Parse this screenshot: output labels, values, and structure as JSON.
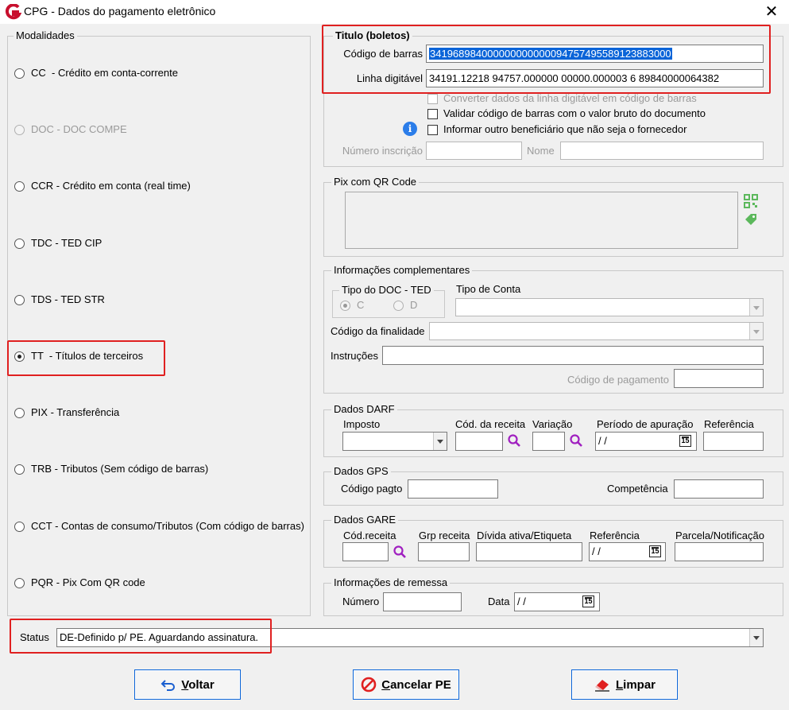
{
  "window": {
    "title": "CPG - Dados do pagamento eletrônico",
    "close": "✕"
  },
  "modalidades": {
    "legend": "Modalidades",
    "items": [
      {
        "label": "CC  - Crédito em conta-corrente",
        "selected": false,
        "disabled": false
      },
      {
        "label": "DOC - DOC COMPE",
        "selected": false,
        "disabled": true
      },
      {
        "label": "CCR - Crédito em conta (real time)",
        "selected": false,
        "disabled": false
      },
      {
        "label": "TDC - TED CIP",
        "selected": false,
        "disabled": false
      },
      {
        "label": "TDS - TED STR",
        "selected": false,
        "disabled": false
      },
      {
        "label": "TT  - Títulos de terceiros",
        "selected": true,
        "disabled": false
      },
      {
        "label": "PIX - Transferência",
        "selected": false,
        "disabled": false
      },
      {
        "label": "TRB - Tributos (Sem código de barras)",
        "selected": false,
        "disabled": false
      },
      {
        "label": "CCT - Contas de consumo/Tributos (Com código de barras)",
        "selected": false,
        "disabled": false
      },
      {
        "label": "PQR - Pix Com QR code",
        "selected": false,
        "disabled": false
      }
    ]
  },
  "titulo": {
    "legend": "Titulo (boletos)",
    "codigo_barras_label": "Código de barras",
    "codigo_barras_value": "34196898400000000000009475749558912388300​0",
    "linha_digitavel_label": "Linha digitável",
    "linha_digitavel_value": "34191.12218 94757.000000 00000.000003 6 89840000064382",
    "chk_converter": "Converter dados da linha digitável em código de barras",
    "chk_validar": "Validar código de barras com o valor bruto do documento",
    "chk_informar": "Informar outro beneficiário que não seja o fornecedor",
    "numero_inscricao_label": "Número inscrição",
    "nome_label": "Nome",
    "info_icon": "i"
  },
  "pix": {
    "legend": "Pix com QR Code"
  },
  "info_compl": {
    "legend": "Informações complementares",
    "tipo_doc_legend": "Tipo do DOC - TED",
    "opt_c": "C",
    "opt_d": "D",
    "tipo_conta_label": "Tipo de Conta",
    "codigo_finalidade_label": "Código da finalidade",
    "instrucoes_label": "Instruções",
    "codigo_pagamento_label": "Código de pagamento"
  },
  "darf": {
    "legend": "Dados DARF",
    "imposto_label": "Imposto",
    "cod_receita_label": "Cód. da receita",
    "variacao_label": "Variação",
    "periodo_label": "Período de apuração",
    "periodo_value": " / /",
    "referencia_label": "Referência",
    "cal": "15"
  },
  "gps": {
    "legend": "Dados GPS",
    "codigo_pagto_label": "Código pagto",
    "competencia_label": "Competência"
  },
  "gare": {
    "legend": "Dados GARE",
    "cod_receita_label": "Cód.receita",
    "grp_receita_label": "Grp receita",
    "divida_label": "Dívida ativa/Etiqueta",
    "referencia_label": "Referência",
    "referencia_value": " / /",
    "parcela_label": "Parcela/Notificação",
    "cal": "15"
  },
  "remessa": {
    "legend": "Informações de remessa",
    "numero_label": "Número",
    "data_label": "Data",
    "data_value": " / /",
    "cal": "15"
  },
  "status": {
    "label": "Status",
    "value": "DE-Definido p/ PE. Aguardando assinatura."
  },
  "buttons": {
    "voltar_u": "V",
    "voltar_rest": "oltar",
    "cancelar_u": "C",
    "cancelar_rest": "ancelar PE",
    "limpar_u": "L",
    "limpar_rest": "impar"
  },
  "colors": {
    "accent": "#0a64d8",
    "highlight": "#e02020",
    "info": "#2b7de9",
    "qr_green": "#5cb85c",
    "magnifier": "#a020c0"
  }
}
